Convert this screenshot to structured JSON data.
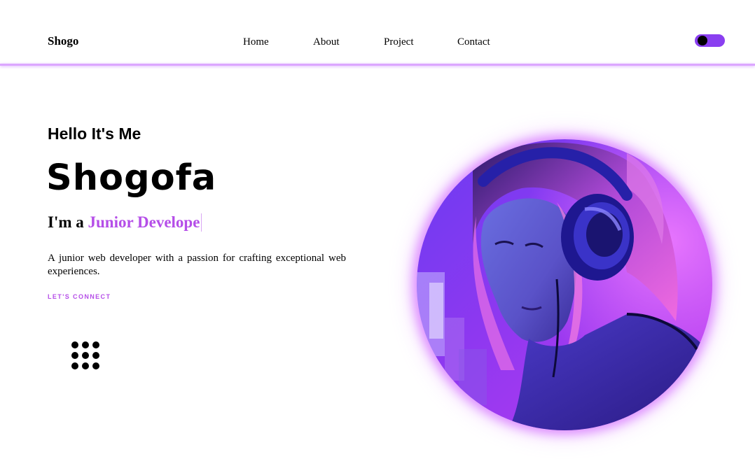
{
  "header": {
    "logo": "Shogo",
    "nav": [
      "Home",
      "About",
      "Project",
      "Contact"
    ],
    "theme_toggle": {
      "state": "on",
      "color": "#8a3ff0"
    }
  },
  "hero": {
    "greeting": "Hello It's Me",
    "name": "Shogofa",
    "role_prefix": "I'm a",
    "role_typed": "Junior Develope",
    "description": "A junior web developer with a passion for crafting exceptional web experiences.",
    "cta": "LET'S CONNECT",
    "menu_icon": "grid-dots-icon"
  },
  "colors": {
    "accent": "#b54ee8",
    "header_line": "#dca6ff",
    "glow": "#d778ff"
  }
}
